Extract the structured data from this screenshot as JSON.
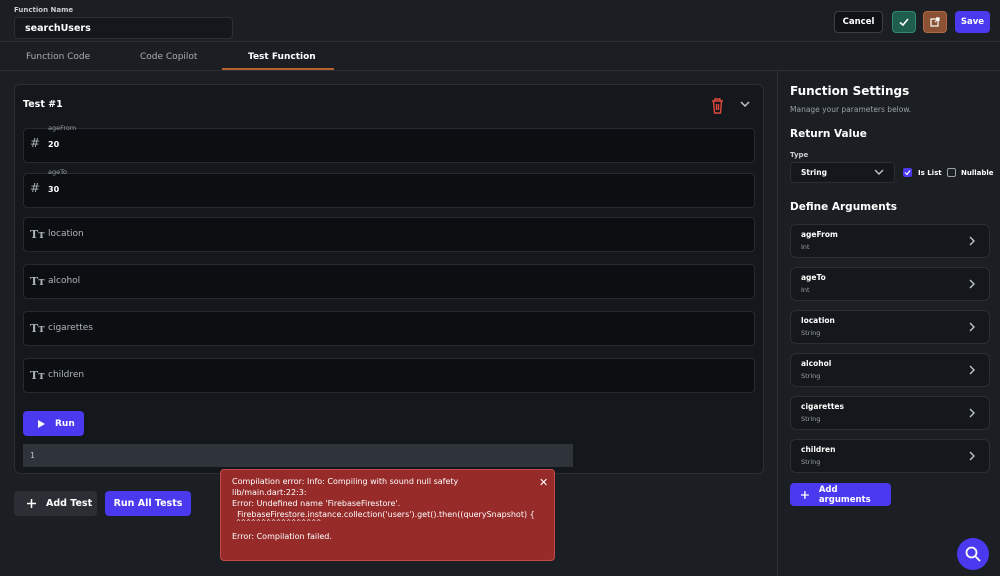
{
  "header": {
    "function_name_label": "Function Name",
    "function_name_value": "searchUsers",
    "cancel_label": "Cancel",
    "save_label": "Save"
  },
  "tabs": [
    {
      "label": "Function Code"
    },
    {
      "label": "Code Copilot"
    },
    {
      "label": "Test Function",
      "active": true
    }
  ],
  "test": {
    "title": "Test #1",
    "fields": [
      {
        "label": "ageFrom",
        "value": "20",
        "icon": "hash-icon"
      },
      {
        "label": "ageTo",
        "value": "30",
        "icon": "hash-icon"
      },
      {
        "placeholder": "location",
        "icon": "text-type-icon"
      },
      {
        "placeholder": "alcohol",
        "icon": "text-type-icon"
      },
      {
        "placeholder": "cigarettes",
        "icon": "text-type-icon"
      },
      {
        "placeholder": "children",
        "icon": "text-type-icon"
      }
    ],
    "run_label": "Run",
    "output_line_number": "1"
  },
  "actions": {
    "add_test_label": "Add Test",
    "run_all_label": "Run All Tests"
  },
  "error": {
    "lines": [
      "Compilation error: Info: Compiling with sound null safety",
      "lib/main.dart:22:3:",
      "Error: Undefined name 'FirebaseFirestore'.",
      "  FirebaseFirestore.instance.collection('users').get().then((querySnapshot) {",
      "  ^^^^^^^^^^^^^^^^^",
      "Error: Compilation failed."
    ]
  },
  "settings": {
    "title": "Function Settings",
    "subtitle": "Manage your parameters below.",
    "return_value_heading": "Return Value",
    "type_label": "Type",
    "type_value": "String",
    "is_list_label": "Is List",
    "is_list_checked": true,
    "nullable_label": "Nullable",
    "nullable_checked": false,
    "define_args_heading": "Define Arguments",
    "arguments": [
      {
        "name": "ageFrom",
        "type": "Int"
      },
      {
        "name": "ageTo",
        "type": "Int"
      },
      {
        "name": "location",
        "type": "String"
      },
      {
        "name": "alcohol",
        "type": "String"
      },
      {
        "name": "cigarettes",
        "type": "String"
      },
      {
        "name": "children",
        "type": "String"
      }
    ],
    "add_arguments_label": "Add arguments"
  },
  "colors": {
    "accent": "#4b39ef",
    "tab_underline": "#b5622e",
    "error_bg": "#962b2a",
    "trash": "#e0483e"
  }
}
